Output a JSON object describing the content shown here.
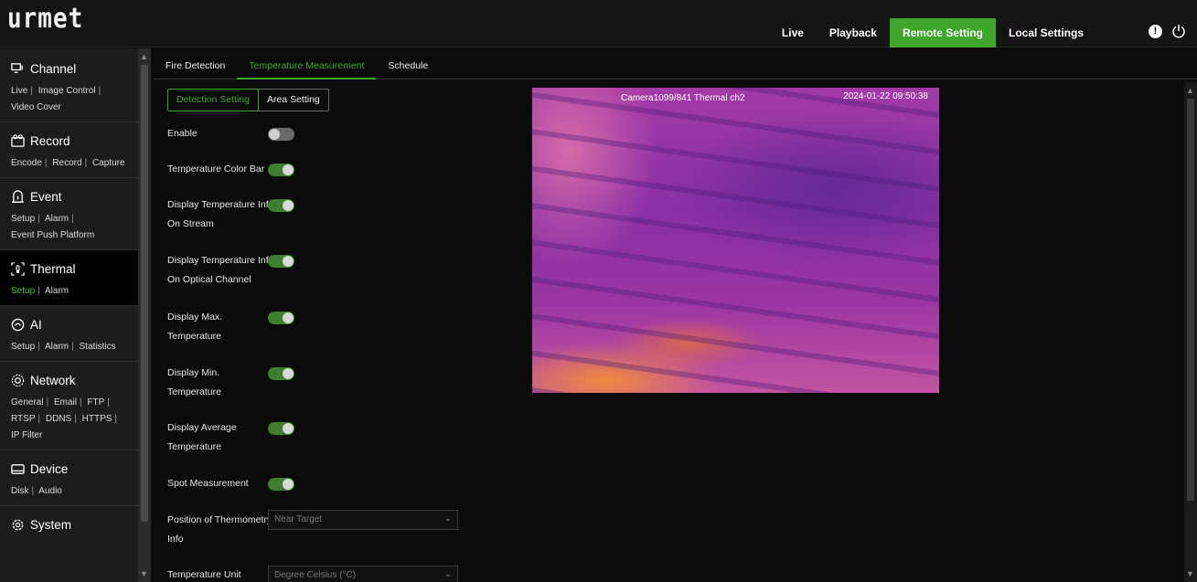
{
  "logo": "urmet",
  "nav": [
    "Live",
    "Playback",
    "Remote Setting",
    "Local Settings"
  ],
  "sidebar": {
    "channel": {
      "title": "Channel",
      "links": [
        "Live",
        "Image Control",
        "Video Cover"
      ]
    },
    "record": {
      "title": "Record",
      "links": [
        "Encode",
        "Record",
        "Capture"
      ]
    },
    "event": {
      "title": "Event",
      "links": [
        "Setup",
        "Alarm",
        "Event Push Platform"
      ]
    },
    "thermal": {
      "title": "Thermal",
      "links": [
        "Setup",
        "Alarm"
      ]
    },
    "ai": {
      "title": "AI",
      "links": [
        "Setup",
        "Alarm",
        "Statistics"
      ]
    },
    "network": {
      "title": "Network",
      "links": [
        "General",
        "Email",
        "FTP",
        "RTSP",
        "DDNS",
        "HTTPS",
        "IP Filter"
      ]
    },
    "device": {
      "title": "Device",
      "links": [
        "Disk",
        "Audio"
      ]
    },
    "system": {
      "title": "System"
    }
  },
  "tabs": [
    "Fire Detection",
    "Temperature Measurement",
    "Schedule"
  ],
  "subtabs": [
    "Detection Setting",
    "Area Setting"
  ],
  "form": {
    "enable": "Enable",
    "color_bar": "Temperature Color Bar",
    "temp_info_stream_1": "Display Temperature Info",
    "temp_info_stream_2": "On Stream",
    "temp_info_optical_1": "Display Temperature Info",
    "temp_info_optical_2": "On Optical Channel",
    "max_1": "Display Max.",
    "max_2": "Temperature",
    "min_1": "Display Min.",
    "min_2": "Temperature",
    "avg_1": "Display Average",
    "avg_2": "Temperature",
    "spot": "Spot Measurement",
    "position_1": "Position of Thermometry",
    "position_2": "Info",
    "position_value": "Near Target",
    "unit": "Temperature Unit",
    "unit_value": "Degree Celsius (°C)"
  },
  "toggles": {
    "enable": false,
    "color_bar": true,
    "stream": true,
    "optical": true,
    "max": true,
    "min": true,
    "avg": true,
    "spot": true
  },
  "camera": {
    "label": "Camera1099/841 Thermal ch2",
    "timestamp": "2024-01-22  09:50:38"
  }
}
